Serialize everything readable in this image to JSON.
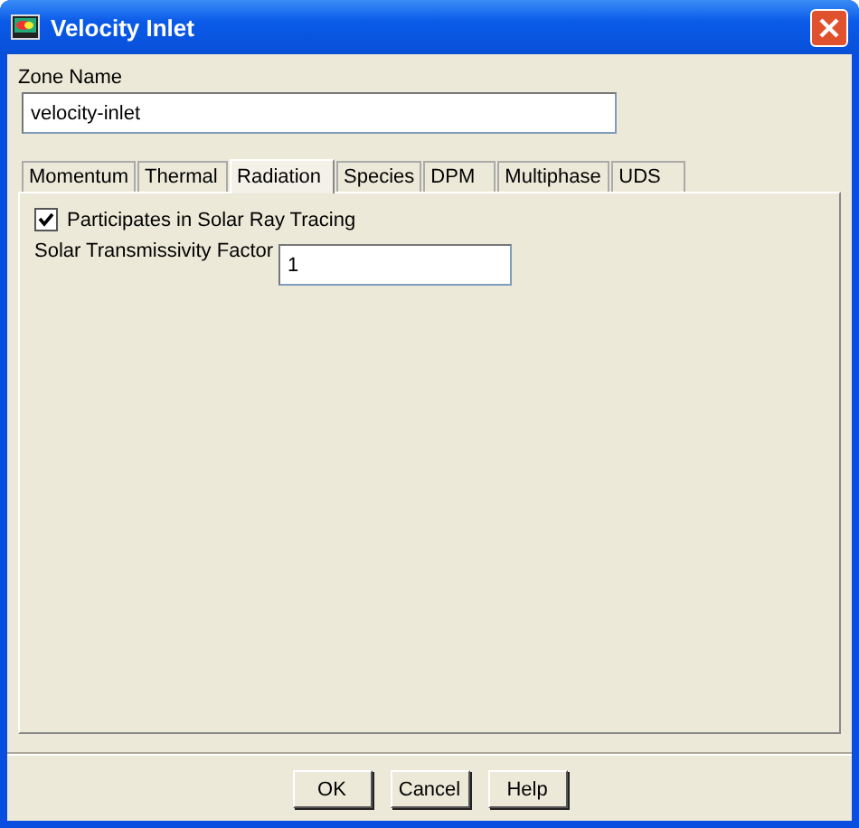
{
  "window": {
    "title": "Velocity Inlet"
  },
  "zone_name": {
    "label": "Zone Name",
    "value": "velocity-inlet"
  },
  "tabs": [
    {
      "label": "Momentum",
      "selected": false
    },
    {
      "label": "Thermal",
      "selected": false
    },
    {
      "label": "Radiation",
      "selected": true
    },
    {
      "label": "Species",
      "selected": false
    },
    {
      "label": "DPM",
      "selected": false
    },
    {
      "label": "Multiphase",
      "selected": false
    },
    {
      "label": "UDS",
      "selected": false
    }
  ],
  "radiation": {
    "solar_ray_tracing": {
      "label": "Participates in Solar Ray Tracing",
      "checked": true
    },
    "solar_transmissivity": {
      "label": "Solar Transmissivity Factor",
      "value": "1"
    }
  },
  "buttons": [
    "OK",
    "Cancel",
    "Help"
  ]
}
